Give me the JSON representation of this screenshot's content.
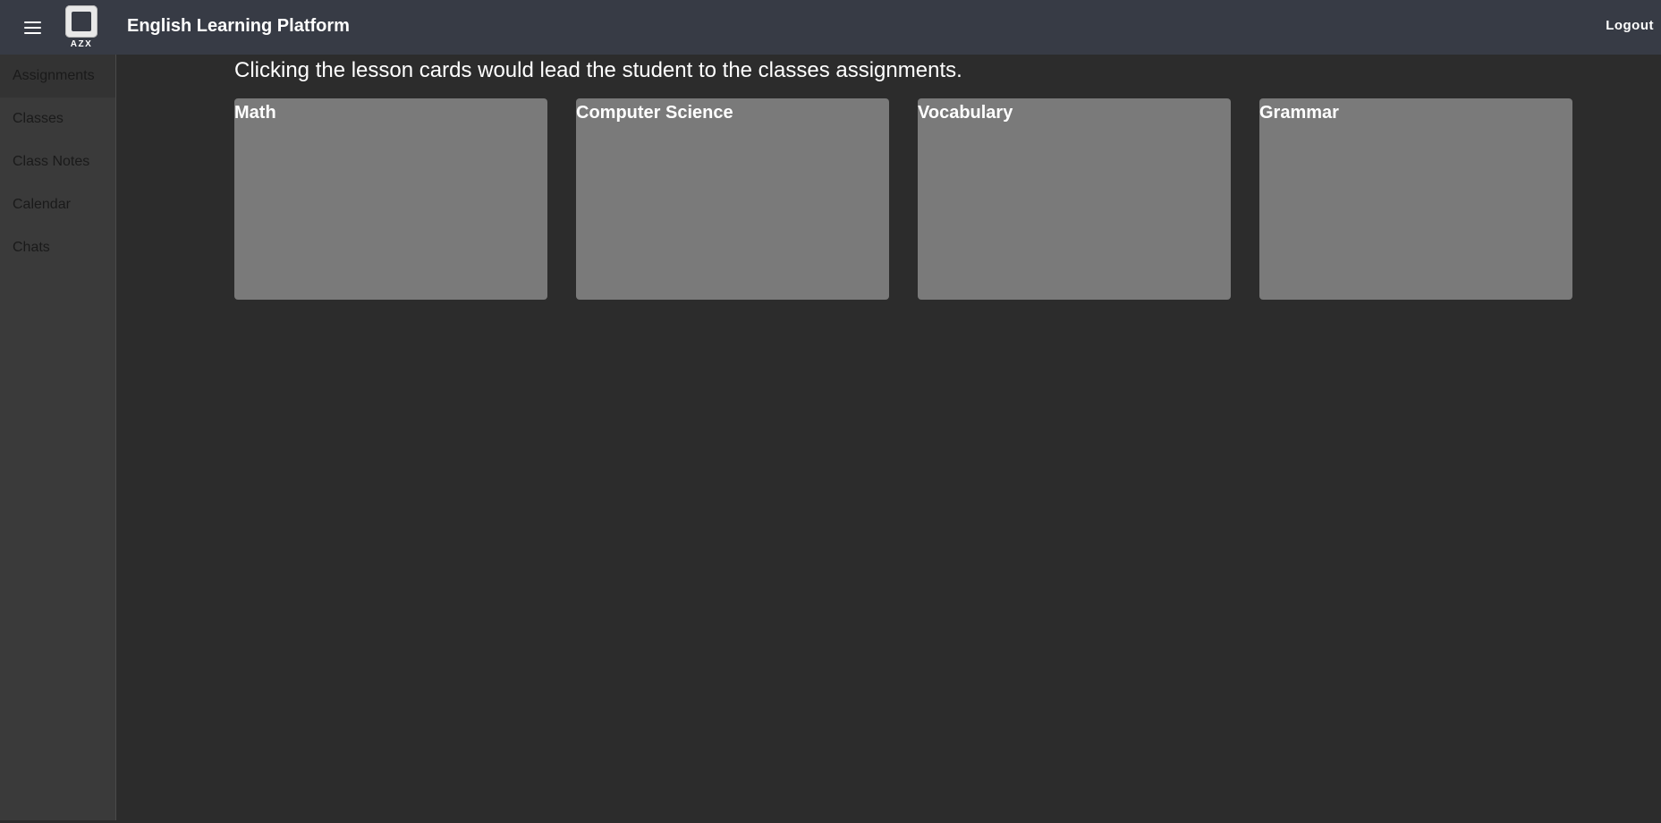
{
  "header": {
    "menu_icon": "hamburger-menu-icon",
    "logo_text": "AZX",
    "title": "English Learning Platform",
    "logout_label": "Logout",
    "background": "#373b45"
  },
  "sidebar": {
    "active_index": 0,
    "items": [
      {
        "label": "Assignments"
      },
      {
        "label": "Classes"
      },
      {
        "label": "Class Notes"
      },
      {
        "label": "Calendar"
      },
      {
        "label": "Chats"
      }
    ]
  },
  "main": {
    "instructions": "Clicking the lesson cards would lead the student to the classes assignments.",
    "cards": [
      {
        "title": "Math"
      },
      {
        "title": "Computer Science"
      },
      {
        "title": "Vocabulary"
      },
      {
        "title": "Grammar"
      }
    ],
    "card_color": "#7a7a7a",
    "background": "#2c2c2c"
  }
}
